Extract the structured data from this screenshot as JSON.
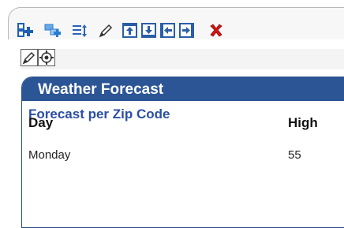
{
  "toolbar": {
    "buttons": [
      {
        "name": "add-portlet-icon",
        "color": "#1f5fb3"
      },
      {
        "name": "copy-portlet-icon",
        "color": "#2a7bd0"
      },
      {
        "name": "reorder-list-icon",
        "color": "#2b64b8"
      },
      {
        "name": "pencil-edit-icon",
        "color": "#333333"
      },
      {
        "name": "move-up-icon",
        "color": "#2a5ea7"
      },
      {
        "name": "move-down-icon",
        "color": "#2a5ea7"
      },
      {
        "name": "move-left-icon",
        "color": "#2a5ea7"
      },
      {
        "name": "move-right-icon",
        "color": "#2a5ea7"
      },
      {
        "name": "delete-icon",
        "color": "#d41616"
      }
    ]
  },
  "edit_strip": {
    "buttons": [
      {
        "name": "edit-pencil-icon"
      },
      {
        "name": "settings-icon"
      }
    ]
  },
  "portlet": {
    "title": "Weather Forecast",
    "subtitle": "Forecast per Zip Code",
    "columns": [
      "Day",
      "High"
    ],
    "rows": [
      [
        "Monday",
        "55"
      ]
    ],
    "header_color": "#2c5596",
    "subtitle_color": "#2b4fa5"
  }
}
